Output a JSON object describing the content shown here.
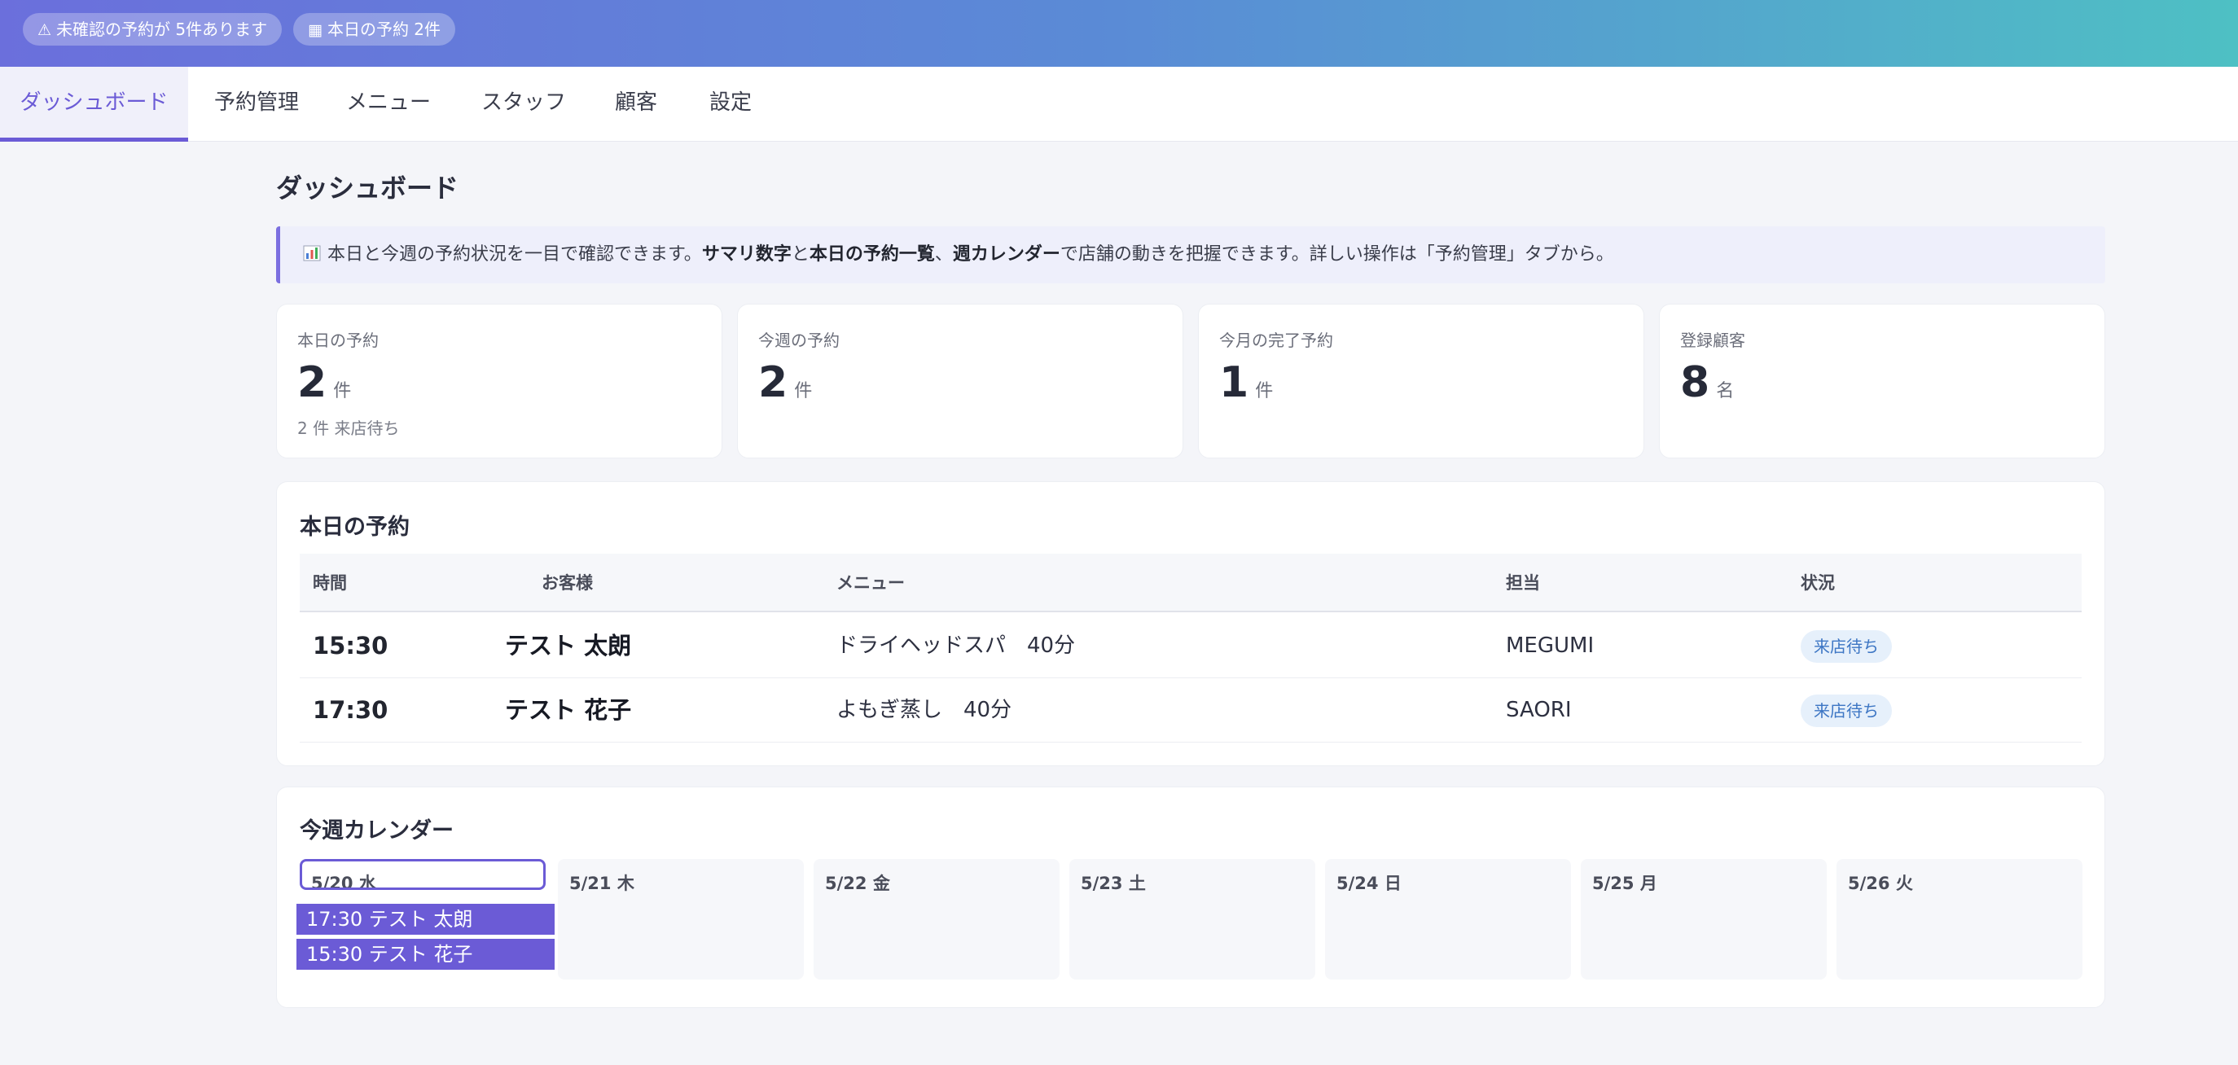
{
  "topbar": {
    "alert_unconfirmed": "未確認の予約が 5件あります",
    "alert_today": "本日の予約 2件",
    "alert_icon": "warning-icon",
    "calendar_icon": "calendar-icon"
  },
  "tabs": [
    {
      "label": "ダッシュボード",
      "active": true
    },
    {
      "label": "予約管理"
    },
    {
      "label": "メニュー"
    },
    {
      "label": "スタッフ"
    },
    {
      "label": "顧客"
    },
    {
      "label": "設定"
    }
  ],
  "page_title": "ダッシュボード",
  "info": {
    "icon": "chart-icon",
    "text1": "本日と今週の予約状況を一目で確認できます。",
    "bold1": "サマリ数字",
    "text2": "と",
    "bold2": "本日の予約一覧",
    "text3": "、",
    "bold3": "週カレンダー",
    "text4": "で店舗の動きを把握できます。詳しい操作は「予約管理」タブから。"
  },
  "stats": [
    {
      "label": "本日の予約",
      "value": "2",
      "unit": "件",
      "sub": "2 件 来店待ち"
    },
    {
      "label": "今週の予約",
      "value": "2",
      "unit": "件"
    },
    {
      "label": "今月の完了予約",
      "value": "1",
      "unit": "件"
    },
    {
      "label": "登録顧客",
      "value": "8",
      "unit": "名"
    }
  ],
  "today": {
    "title": "本日の予約",
    "columns": [
      "時間",
      "お客様",
      "メニュー",
      "担当",
      "状況"
    ],
    "rows": [
      {
        "time": "15:30",
        "customer": "テスト 太朗",
        "menu": "ドライヘッドスパ　40分",
        "staff": "MEGUMI",
        "status": "来店待ち"
      },
      {
        "time": "17:30",
        "customer": "テスト 花子",
        "menu": "よもぎ蒸し　40分",
        "staff": "SAORI",
        "status": "来店待ち"
      }
    ]
  },
  "calendar": {
    "title": "今週カレンダー",
    "days": [
      "5/20 水",
      "5/21 木",
      "5/22 金",
      "5/23 土",
      "5/24 日",
      "5/25 月",
      "5/26 火"
    ],
    "events": [
      "17:30 テスト 太朗",
      "15:30 テスト 花子"
    ]
  },
  "colors": {
    "accent": "#6b5bd6",
    "gradient_start": "#6b6fdc",
    "gradient_end": "#4ec0c4",
    "status_bg": "#e6f0fb",
    "status_text": "#3d76c4"
  }
}
